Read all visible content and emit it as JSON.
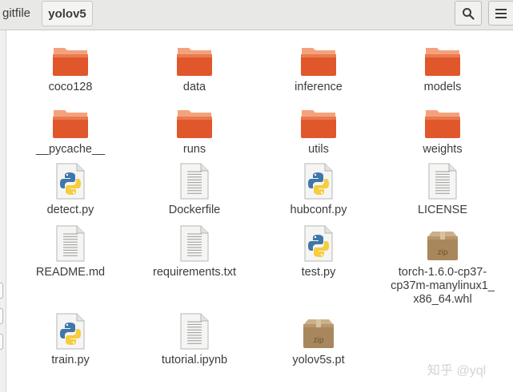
{
  "breadcrumb": {
    "parent": "gitfile",
    "current": "yolov5"
  },
  "toolbar": {
    "search_icon": "search-icon",
    "menu_icon": "hamburger-menu-icon"
  },
  "files": [
    {
      "name": "coco128",
      "type": "folder"
    },
    {
      "name": "data",
      "type": "folder"
    },
    {
      "name": "inference",
      "type": "folder"
    },
    {
      "name": "models",
      "type": "folder"
    },
    {
      "name": "__pycache__",
      "type": "folder"
    },
    {
      "name": "runs",
      "type": "folder"
    },
    {
      "name": "utils",
      "type": "folder"
    },
    {
      "name": "weights",
      "type": "folder"
    },
    {
      "name": "detect.py",
      "type": "python"
    },
    {
      "name": "Dockerfile",
      "type": "text"
    },
    {
      "name": "hubconf.py",
      "type": "python"
    },
    {
      "name": "LICENSE",
      "type": "text"
    },
    {
      "name": "README.md",
      "type": "text"
    },
    {
      "name": "requirements.txt",
      "type": "text"
    },
    {
      "name": "test.py",
      "type": "python"
    },
    {
      "name": "torch-1.6.0-cp37-cp37m-manylinux1_x86_64.whl",
      "type": "zip",
      "zip_label": "zip",
      "display_lines": [
        "torch-1.6.0-cp37-",
        "cp37m-manylinux1_",
        "x86_64.whl"
      ]
    },
    {
      "name": "train.py",
      "type": "python"
    },
    {
      "name": "tutorial.ipynb",
      "type": "text"
    },
    {
      "name": "yolov5s.pt",
      "type": "zip",
      "zip_label": "zip"
    }
  ],
  "watermark": "知乎 @yql",
  "colors": {
    "folder_top": "#f4a27c",
    "folder_body": "#e0572b",
    "header_bg": "#e8e8e7"
  }
}
